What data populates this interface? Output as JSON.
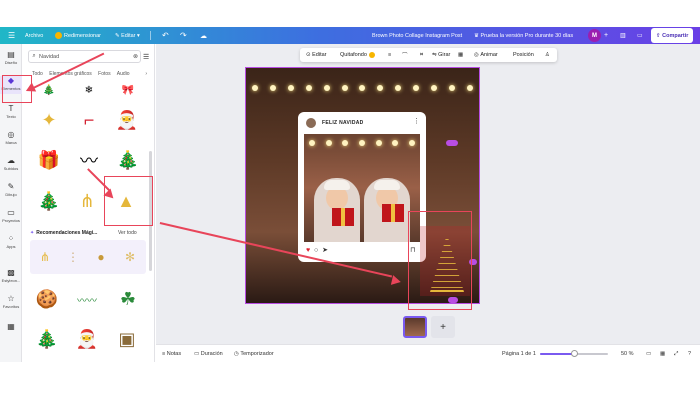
{
  "topbar": {
    "archivo": "Archivo",
    "redimensionar": "Redimensionar",
    "editar": "Editar",
    "title": "Brown Photo Collage Instagram Post",
    "pro_offer": "Prueba la versión Pro durante 30 días",
    "avatar_initial": "M",
    "share": "Compartir"
  },
  "leftrail": [
    {
      "label": "Diseño",
      "icon": "layout-icon"
    },
    {
      "label": "Elementos",
      "icon": "elements-icon"
    },
    {
      "label": "Texto",
      "icon": "text-icon"
    },
    {
      "label": "Marca",
      "icon": "brand-icon"
    },
    {
      "label": "Subidos",
      "icon": "upload-icon"
    },
    {
      "label": "Dibujo",
      "icon": "draw-icon"
    },
    {
      "label": "Proyectos",
      "icon": "folder-icon"
    },
    {
      "label": "Apps",
      "icon": "apps-icon"
    },
    {
      "label": "Estyleon...",
      "icon": "brand-kit-icon"
    },
    {
      "label": "Favoritos",
      "icon": "star-icon"
    }
  ],
  "panel": {
    "search_value": "Navidad",
    "tabs": [
      "Todo",
      "Elementos gráficos",
      "Fotos",
      "Audio"
    ],
    "reco_title": "Recomendaciones Mági...",
    "reco_all": "Ver todo"
  },
  "toolbar": {
    "editar": "Editar",
    "quitafondo": "Quitafondo",
    "girar": "Girar",
    "animar": "Animar",
    "posicion": "Posición"
  },
  "post": {
    "name": "FELIZ NAVIDAD"
  },
  "statusbar": {
    "notas": "Notas",
    "duracion": "Duración",
    "temporizador": "Temporizador",
    "pagina": "Página 1 de 1",
    "zoom": "50 %",
    "zoom_level": 0.5
  },
  "colors": {
    "accent": "#7a5af0",
    "annotation": "#e8455a",
    "selection": "#b84de3"
  }
}
